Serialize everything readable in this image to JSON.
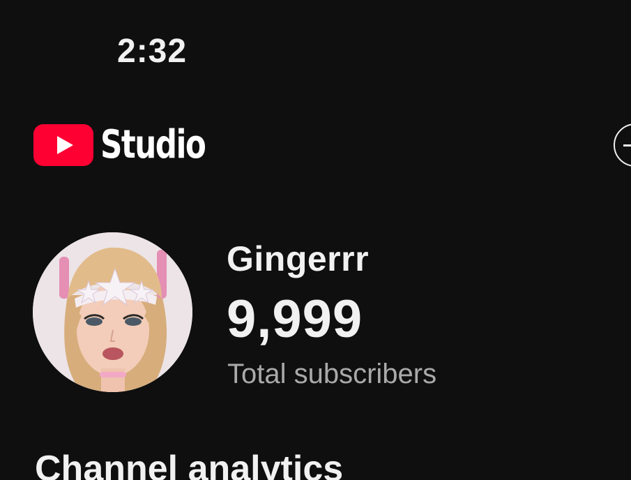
{
  "status_bar": {
    "time": "2:32"
  },
  "header": {
    "logo_icon": "youtube-play-logo-icon",
    "app_name": "Studio",
    "brand_color": "#ff0033",
    "create_icon": "create-plus-circle-icon"
  },
  "channel": {
    "avatar": "channel-avatar-illustration",
    "name": "Gingerrr",
    "subscriber_count": "9,999",
    "subscriber_label": "Total subscribers"
  },
  "sections": {
    "analytics_title": "Channel analytics"
  },
  "colors": {
    "background": "#0f0f0f",
    "primary_text": "#f1f1f1",
    "secondary_text": "#aaaaaa"
  }
}
